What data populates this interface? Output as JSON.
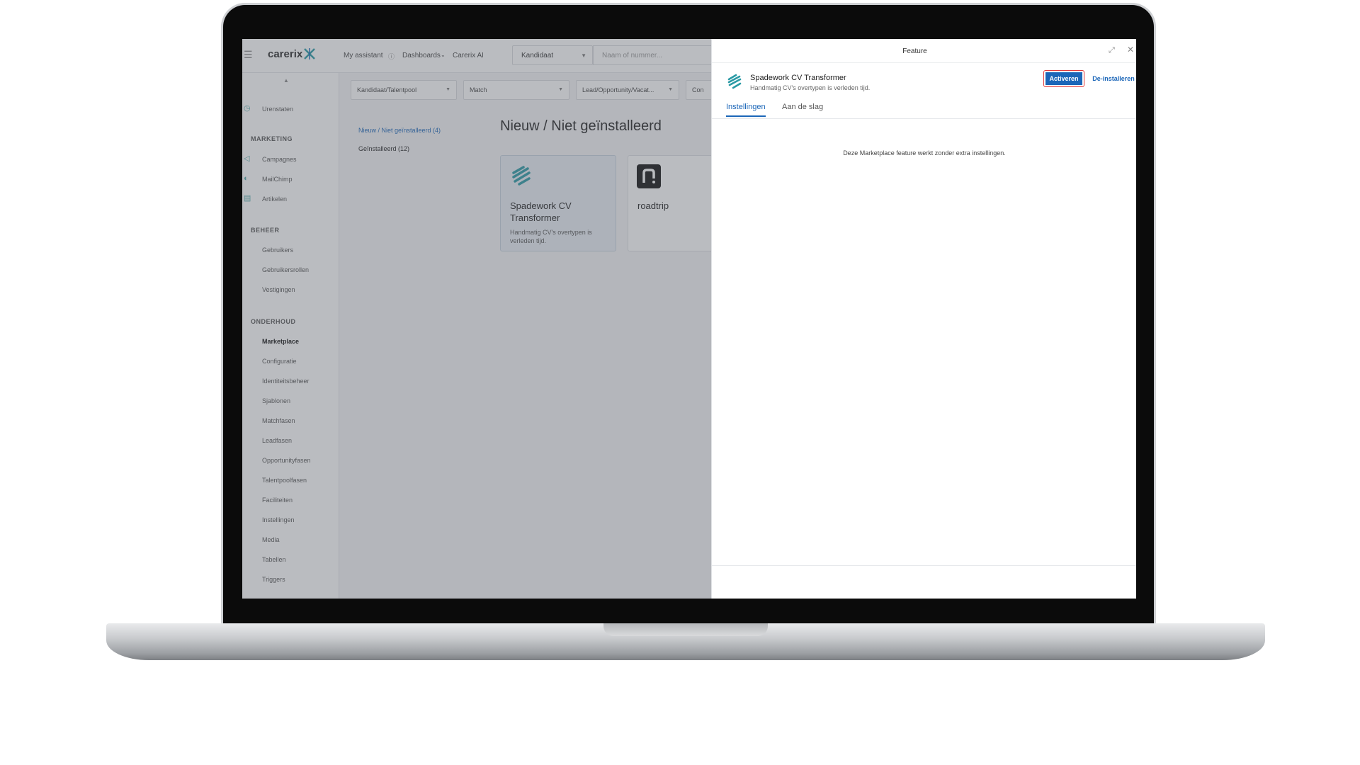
{
  "app": {
    "logo": "carerix",
    "top_links": [
      "My assistant",
      "Dashboards",
      "Carerix AI"
    ],
    "entity_select": "Kandidaat",
    "search_placeholder": "Naam of nummer..."
  },
  "sidebar": {
    "items_top": [
      "Urenstaten"
    ],
    "sections": [
      {
        "title": "MARKETING",
        "items": [
          "Campagnes",
          "MailChimp",
          "Artikelen"
        ]
      },
      {
        "title": "BEHEER",
        "items": [
          "Gebruikers",
          "Gebruikersrollen",
          "Vestigingen"
        ]
      },
      {
        "title": "ONDERHOUD",
        "items": [
          "Marketplace",
          "Configuratie",
          "Identiteitsbeheer",
          "Sjablonen",
          "Matchfasen",
          "Leadfasen",
          "Opportunityfasen",
          "Talentpoolfasen",
          "Faciliteiten",
          "Instellingen",
          "Media",
          "Tabellen",
          "Triggers"
        ]
      }
    ],
    "active_item": "Marketplace"
  },
  "filters": [
    "Kandidaat/Talentpool",
    "Match",
    "Lead/Opportunity/Vacat...",
    "Con"
  ],
  "marketplace": {
    "nav": [
      "Nieuw / Niet geïnstalleerd (4)",
      "Geïnstalleerd (12)"
    ],
    "title": "Nieuw / Niet geïnstalleerd",
    "cards": [
      {
        "title": "Spadework CV Transformer",
        "desc": "Handmatig CV's overtypen is verleden tijd."
      },
      {
        "title": "roadtrip",
        "desc": ""
      }
    ]
  },
  "panel": {
    "title": "Feature",
    "feature_name": "Spadework CV Transformer",
    "feature_desc": "Handmatig CV's overtypen is verleden tijd.",
    "activate_label": "Activeren",
    "deinstall_label": "De-installeren",
    "tabs": [
      "Instellingen",
      "Aan de slag"
    ],
    "active_tab": "Instellingen",
    "message": "Deze Marketplace feature werkt zonder extra instellingen."
  },
  "colors": {
    "accent": "#1b66b8",
    "highlight_outline": "#e03a3a",
    "brand_teal": "#2a9aa5"
  }
}
